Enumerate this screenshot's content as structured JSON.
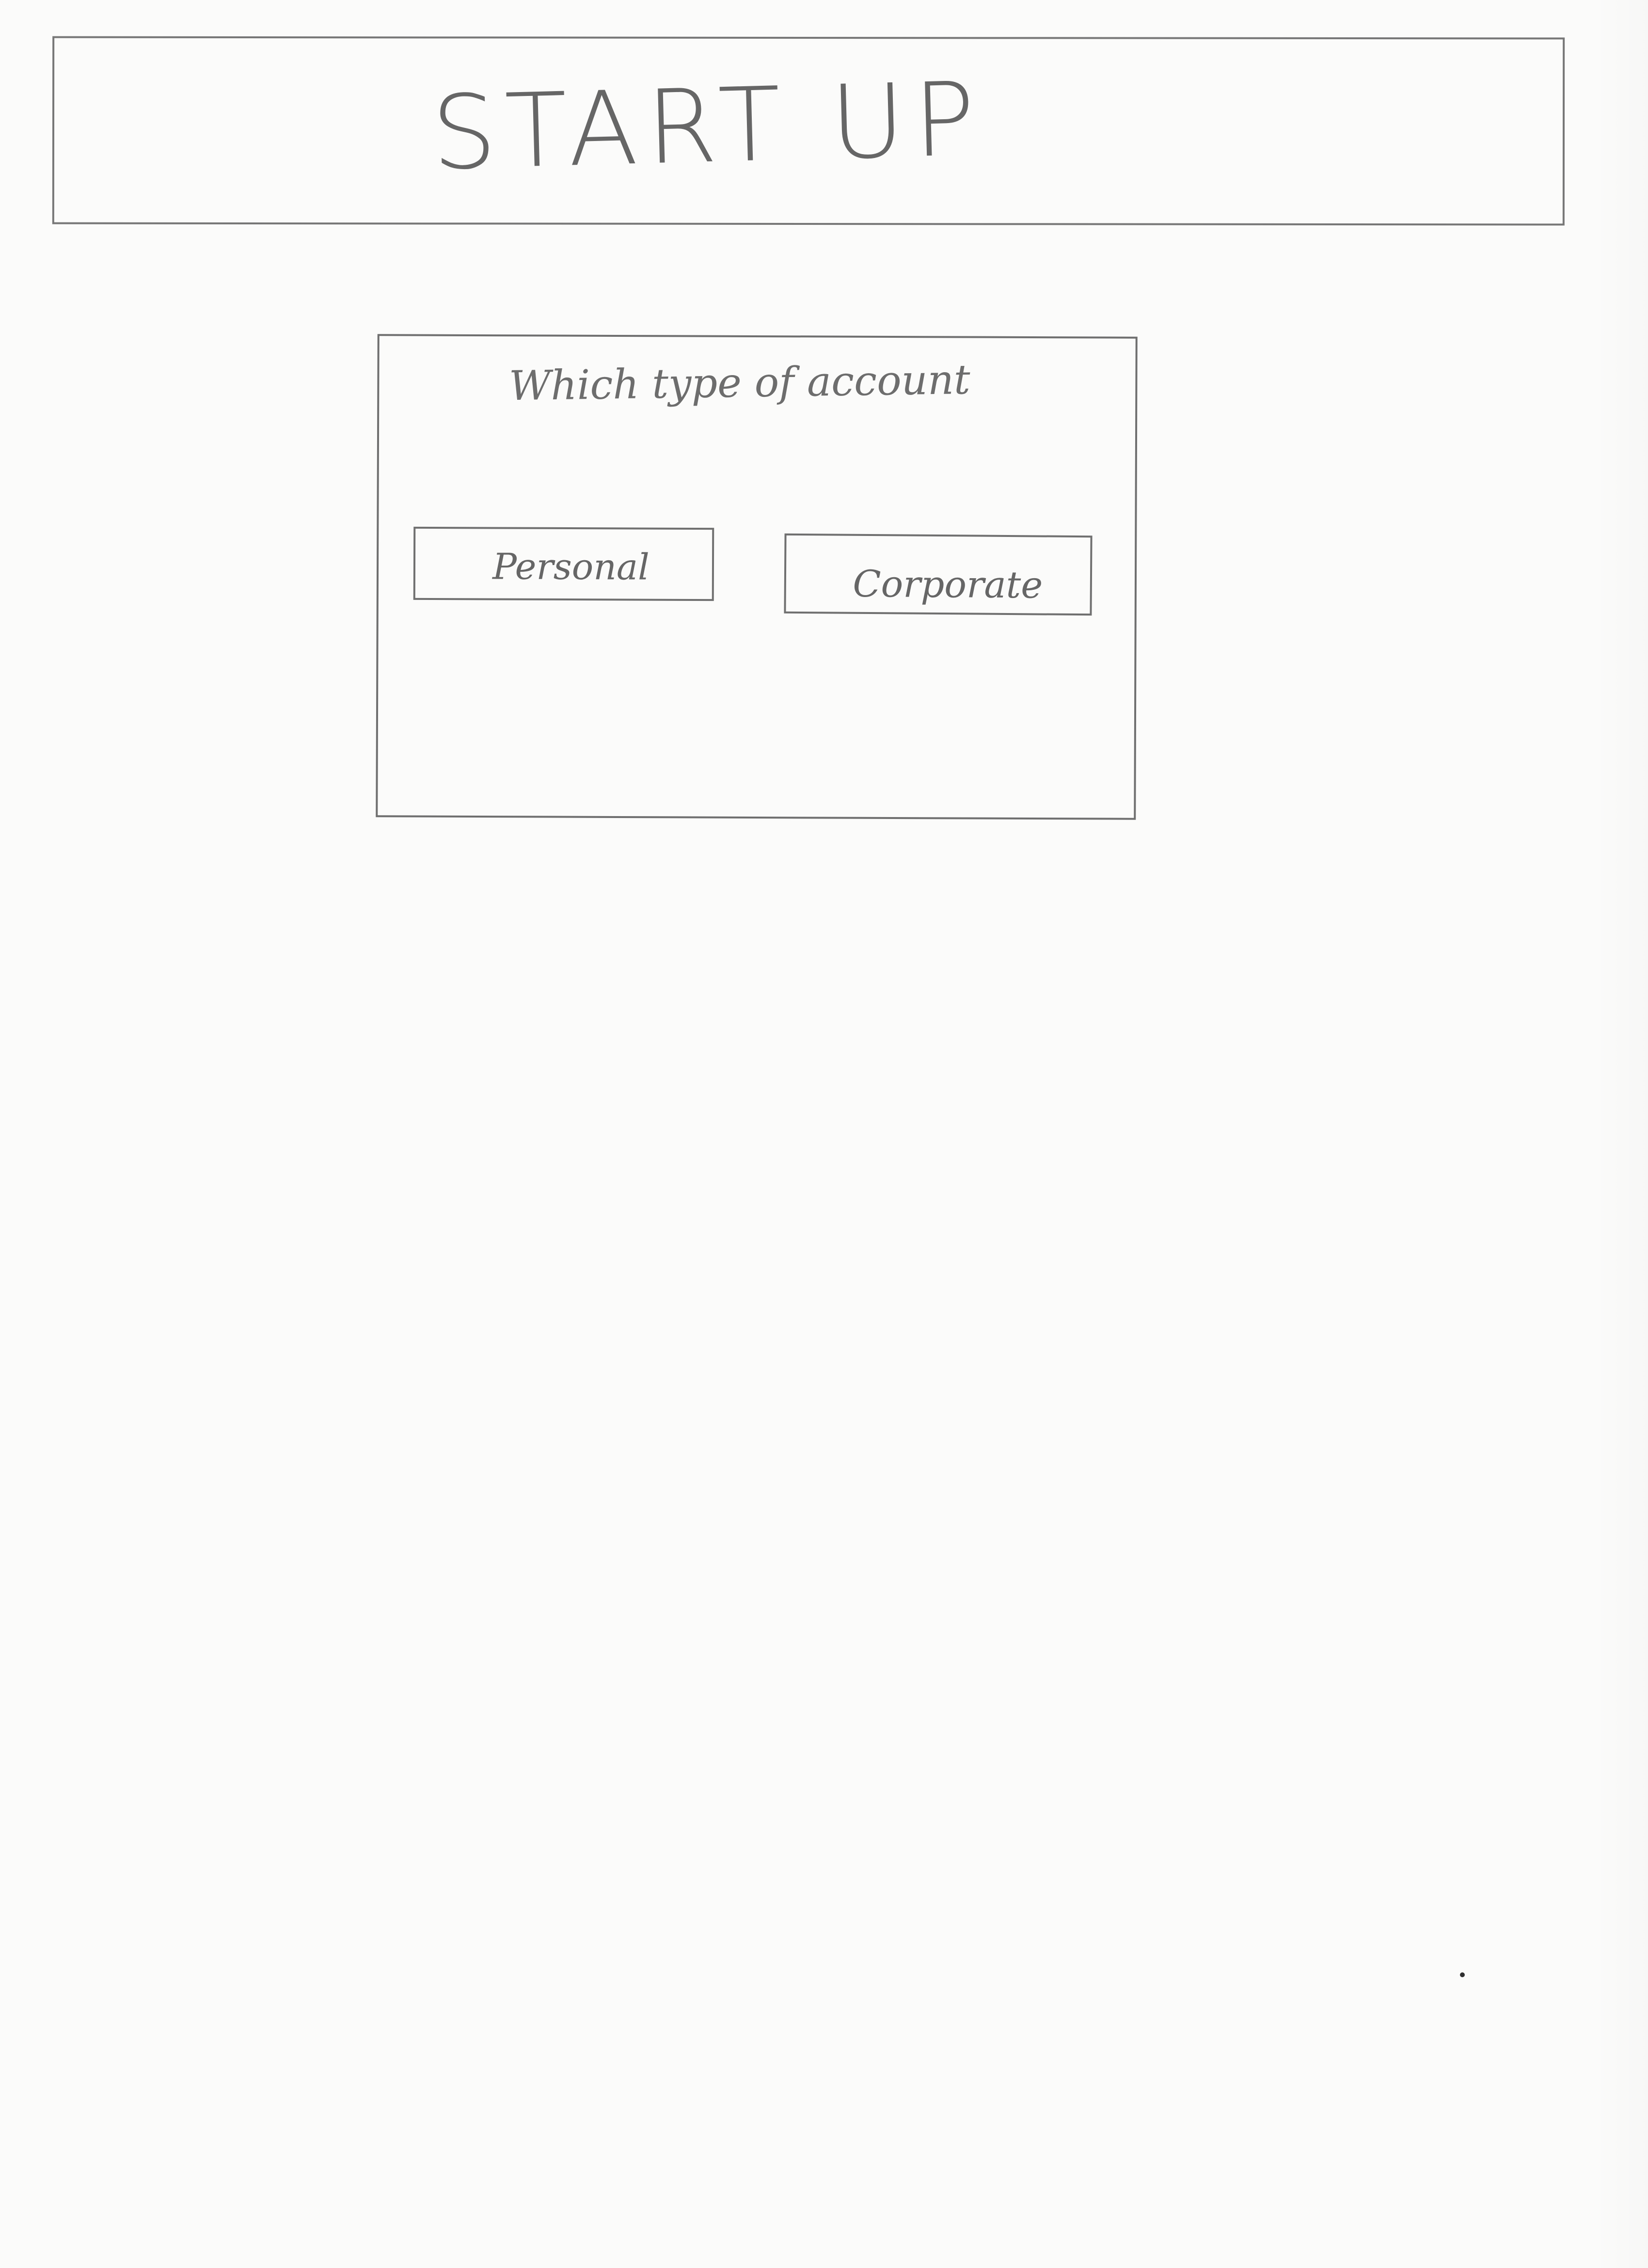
{
  "header": {
    "title": "START UP"
  },
  "dialog": {
    "title": "Which type of account",
    "options": [
      {
        "label": "Personal"
      },
      {
        "label": "Corporate"
      }
    ]
  }
}
